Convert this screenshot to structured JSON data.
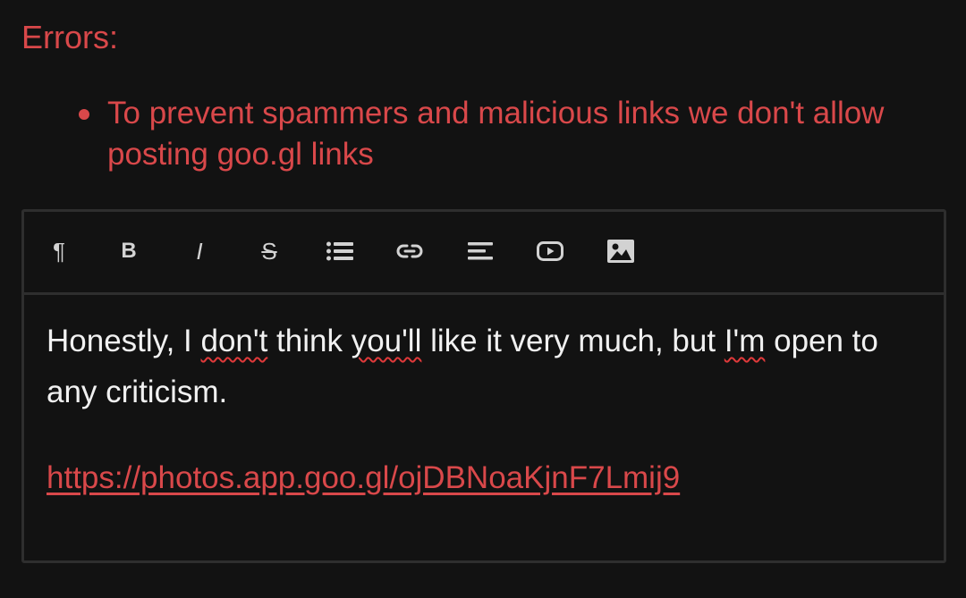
{
  "errors": {
    "title": "Errors:",
    "items": [
      "To prevent spammers and malicious links we don't allow posting goo.gl links"
    ]
  },
  "toolbar": {
    "buttons": [
      {
        "name": "paragraph",
        "icon": "pilcrow-icon",
        "glyph": "¶"
      },
      {
        "name": "bold",
        "icon": "bold-icon",
        "glyph": "B"
      },
      {
        "name": "italic",
        "icon": "italic-icon",
        "glyph": "I"
      },
      {
        "name": "strikethrough",
        "icon": "strikethrough-icon",
        "glyph": "S"
      },
      {
        "name": "list",
        "icon": "list-icon"
      },
      {
        "name": "link",
        "icon": "link-icon"
      },
      {
        "name": "align",
        "icon": "align-left-icon"
      },
      {
        "name": "video",
        "icon": "video-icon"
      },
      {
        "name": "image",
        "icon": "image-icon"
      }
    ]
  },
  "editor": {
    "line1_a": "Honestly, I ",
    "misspelled_1": "don't",
    "line1_b": " think ",
    "misspelled_2": "you'll",
    "line1_c": " like it very much, but ",
    "misspelled_3": "I'm",
    "line1_d": " open to any criticism.",
    "link": "https://photos.app.goo.gl/ojDBNoaKjnF7Lmij9"
  },
  "colors": {
    "background": "#121212",
    "error": "#d9484a",
    "text": "#f1f1f1",
    "icon": "#d2d2d2",
    "border": "#2e2e2e"
  }
}
